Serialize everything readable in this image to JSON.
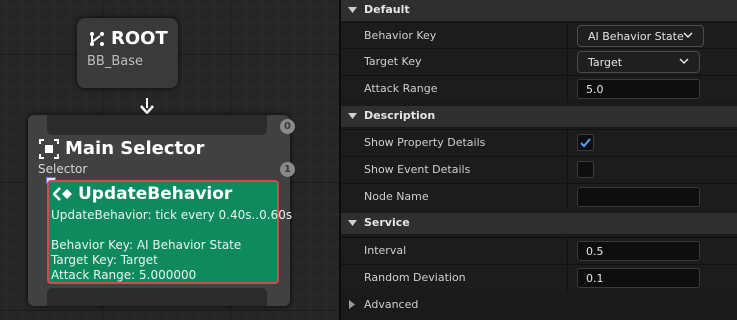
{
  "graph": {
    "root_node": {
      "title": "ROOT",
      "subtitle": "BB_Base"
    },
    "selector_node": {
      "title": "Main Selector",
      "subtitle": "Selector",
      "top_index": "0",
      "service_index": "1"
    },
    "service_node": {
      "title": "UpdateBehavior",
      "tick_line": "UpdateBehavior: tick every 0.40s..0.60s",
      "behavior_key_line": "Behavior Key: AI Behavior State",
      "target_key_line": "Target Key: Target",
      "attack_range_line": "Attack Range: 5.000000"
    }
  },
  "details": {
    "default": {
      "label": "Default",
      "behavior_key": {
        "label": "Behavior Key",
        "value": "AI Behavior State"
      },
      "target_key": {
        "label": "Target Key",
        "value": "Target"
      },
      "attack_range": {
        "label": "Attack Range",
        "value": "5.0"
      }
    },
    "description": {
      "label": "Description",
      "show_property_details": {
        "label": "Show Property Details",
        "checked": true
      },
      "show_event_details": {
        "label": "Show Event Details",
        "checked": false
      },
      "node_name": {
        "label": "Node Name",
        "value": ""
      }
    },
    "service": {
      "label": "Service",
      "interval": {
        "label": "Interval",
        "value": "0.5"
      },
      "random_deviation": {
        "label": "Random Deviation",
        "value": "0.1"
      }
    },
    "advanced": {
      "label": "Advanced"
    }
  },
  "colors": {
    "service_node": "#0f8a5f",
    "selected_outline": "#d24a4a",
    "checkmark": "#4da3ff"
  }
}
